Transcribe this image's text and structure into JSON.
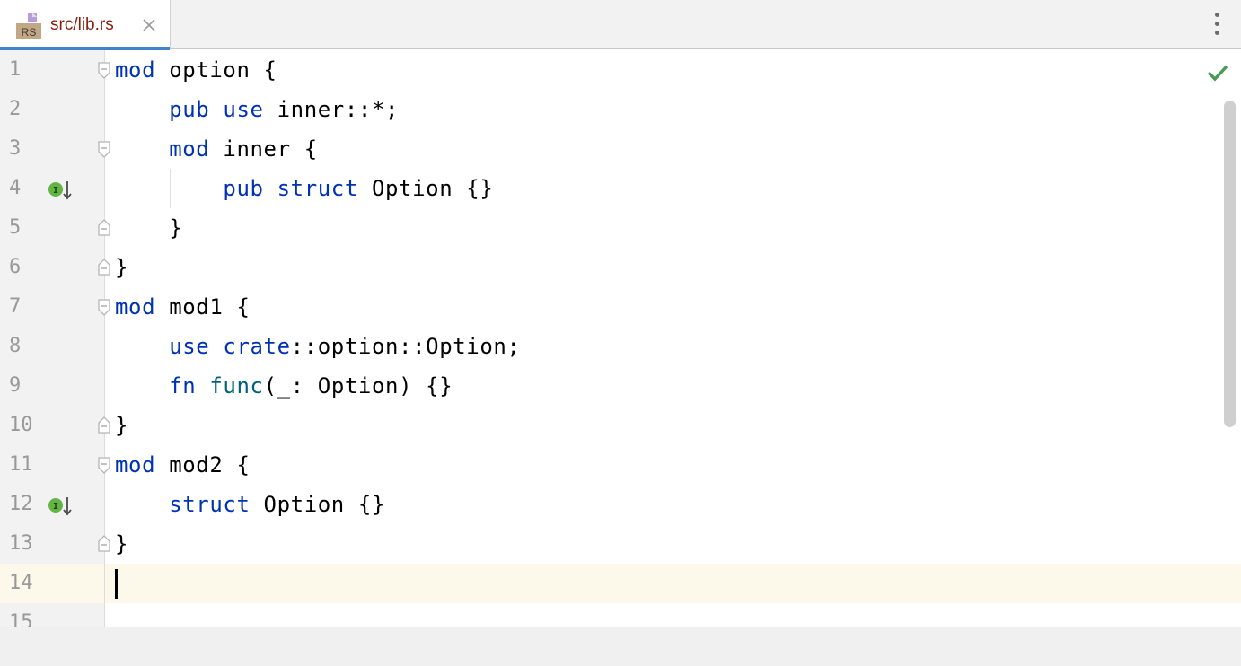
{
  "tab": {
    "file_icon_label": "RS",
    "title": "src/lib.rs",
    "close_icon": "close-icon"
  },
  "toolbar": {
    "more_icon": "more-vertical-icon"
  },
  "editor": {
    "status_icon": "check-icon",
    "status_color": "#499c54",
    "keyword_color": "#0033b3",
    "function_color": "#00627a",
    "caret_line": 14,
    "lines": [
      {
        "n": "1",
        "text": "mod option {"
      },
      {
        "n": "2",
        "text": "    pub use inner::*;"
      },
      {
        "n": "3",
        "text": "    mod inner {"
      },
      {
        "n": "4",
        "text": "        pub struct Option {}"
      },
      {
        "n": "5",
        "text": "    }"
      },
      {
        "n": "6",
        "text": "}"
      },
      {
        "n": "7",
        "text": "mod mod1 {"
      },
      {
        "n": "8",
        "text": "    use crate::option::Option;"
      },
      {
        "n": "9",
        "text": "    fn func(_: Option) {}"
      },
      {
        "n": "10",
        "text": "}"
      },
      {
        "n": "11",
        "text": "mod mod2 {"
      },
      {
        "n": "12",
        "text": "    struct Option {}"
      },
      {
        "n": "13",
        "text": "}"
      },
      {
        "n": "14",
        "text": ""
      },
      {
        "n": "15",
        "text": ""
      }
    ]
  }
}
